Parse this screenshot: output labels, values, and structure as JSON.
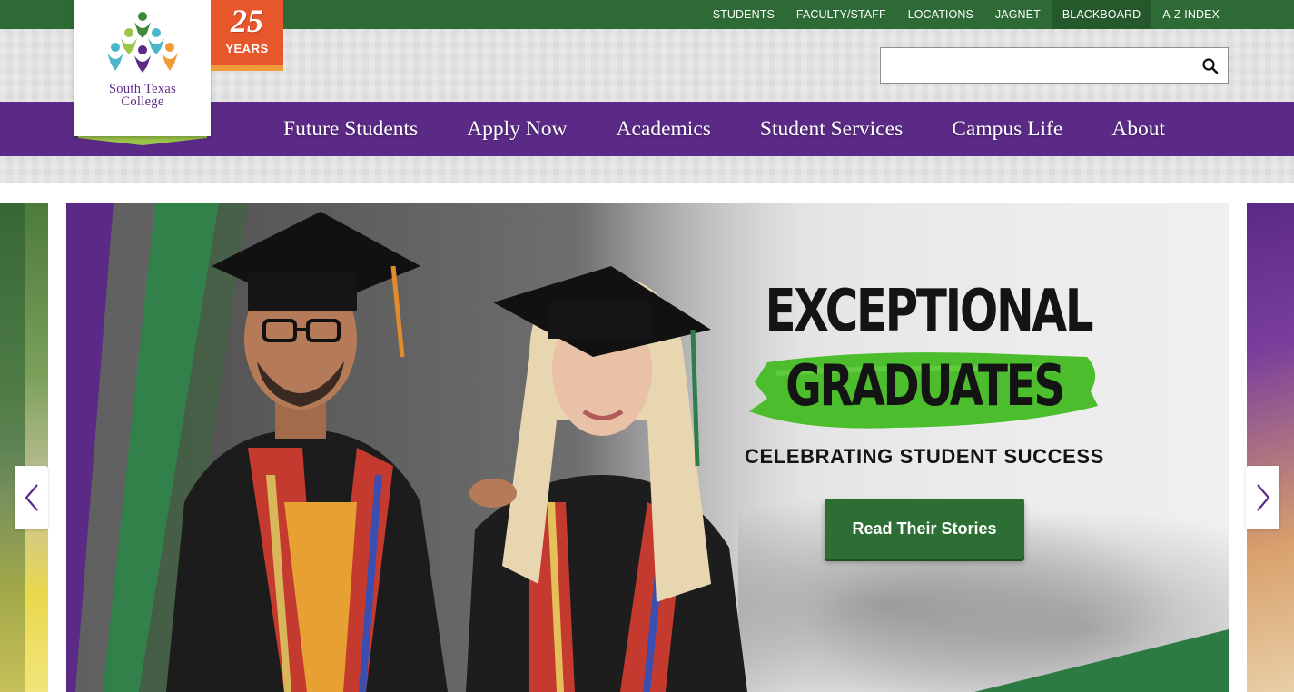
{
  "utility_nav": [
    {
      "label": "STUDENTS"
    },
    {
      "label": "FACULTY/STAFF"
    },
    {
      "label": "LOCATIONS"
    },
    {
      "label": "JAGNET"
    },
    {
      "label": "BLACKBOARD"
    },
    {
      "label": "A-Z INDEX"
    }
  ],
  "logo": {
    "line1": "South Texas",
    "line2": "College"
  },
  "badge": {
    "number": "25",
    "label": "YEARS"
  },
  "search": {
    "value": "",
    "placeholder": "",
    "icon": "search-icon"
  },
  "main_nav": [
    {
      "label": "Future Students"
    },
    {
      "label": "Apply Now"
    },
    {
      "label": "Academics"
    },
    {
      "label": "Student Services"
    },
    {
      "label": "Campus Life"
    },
    {
      "label": "About"
    }
  ],
  "hero": {
    "headline_line1": "EXCEPTIONAL",
    "headline_line2": "GRADUATES",
    "subheading": "CELEBRATING STUDENT SUCCESS",
    "cta_label": "Read Their Stories"
  },
  "colors": {
    "topbar_green": "#2d6a35",
    "nav_purple": "#5b2a86",
    "badge_orange": "#e8562b",
    "cta_green": "#2c6e33",
    "brush_green": "#4cbd2c"
  }
}
